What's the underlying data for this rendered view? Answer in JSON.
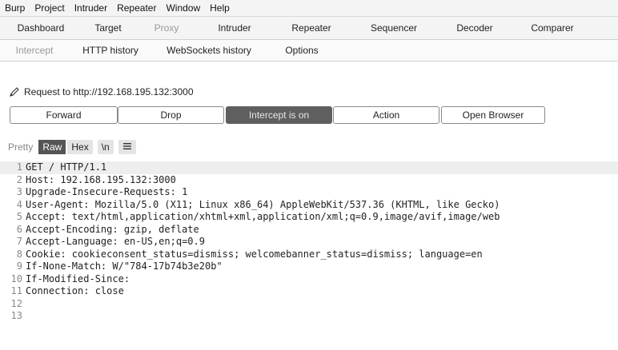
{
  "menu": [
    "Burp",
    "Project",
    "Intruder",
    "Repeater",
    "Window",
    "Help"
  ],
  "main_tabs": [
    "Dashboard",
    "Target",
    "Proxy",
    "Intruder",
    "Repeater",
    "Sequencer",
    "Decoder",
    "Comparer"
  ],
  "active_main_tab": "Proxy",
  "sub_tabs": [
    "Intercept",
    "HTTP history",
    "WebSockets history",
    "Options"
  ],
  "active_sub_tab": "Intercept",
  "request_info": "Request to http://192.168.195.132:3000",
  "buttons": {
    "forward": "Forward",
    "drop": "Drop",
    "intercept": "Intercept is on",
    "action": "Action",
    "open_browser": "Open Browser"
  },
  "view_options": {
    "pretty": "Pretty",
    "raw": "Raw",
    "hex": "Hex",
    "newline": "\\n",
    "menu_icon": "hamburger-icon"
  },
  "request_lines": [
    "GET / HTTP/1.1",
    "Host: 192.168.195.132:3000",
    "Upgrade-Insecure-Requests: 1",
    "User-Agent: Mozilla/5.0 (X11; Linux x86_64) AppleWebKit/537.36 (KHTML, like Gecko)",
    "Accept: text/html,application/xhtml+xml,application/xml;q=0.9,image/avif,image/web",
    "Accept-Encoding: gzip, deflate",
    "Accept-Language: en-US,en;q=0.9",
    "Cookie: cookieconsent_status=dismiss; welcomebanner_status=dismiss; language=en",
    "If-None-Match: W/\"784-17b74b3e20b\"",
    "If-Modified-Since:",
    "Connection: close",
    "",
    ""
  ]
}
